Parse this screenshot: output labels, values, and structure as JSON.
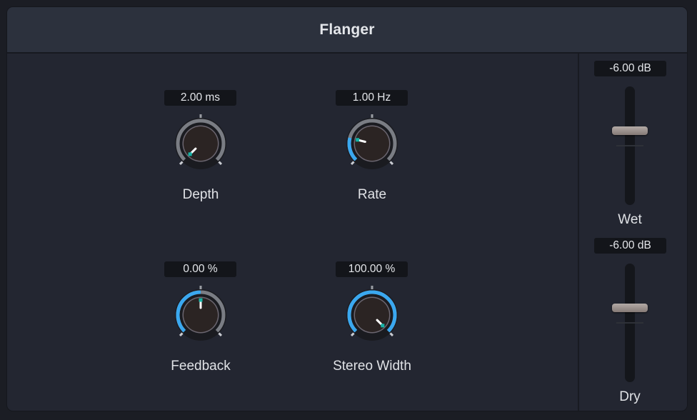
{
  "plugin": {
    "title": "Flanger"
  },
  "colors": {
    "accent": "#3aa8f0",
    "indicator": "#14b3a6",
    "pointer": "#ffffff",
    "knob_face": "#2b2423",
    "ring_inactive": "#7a7d84"
  },
  "knobs": [
    {
      "name": "depth",
      "label": "Depth",
      "value_text": "2.00 ms",
      "position": 0.0,
      "arc": "none"
    },
    {
      "name": "rate",
      "label": "Rate",
      "value_text": "1.00 Hz",
      "position": 0.22,
      "arc": "min"
    },
    {
      "name": "feedback",
      "label": "Feedback",
      "value_text": "0.00 %",
      "position": 0.5,
      "arc": "min"
    },
    {
      "name": "stereo-width",
      "label": "Stereo Width",
      "value_text": "100.00 %",
      "position": 1.0,
      "arc": "min"
    }
  ],
  "faders": [
    {
      "name": "wet",
      "label": "Wet",
      "value_text": "-6.00 dB"
    },
    {
      "name": "dry",
      "label": "Dry",
      "value_text": "-6.00 dB"
    }
  ]
}
